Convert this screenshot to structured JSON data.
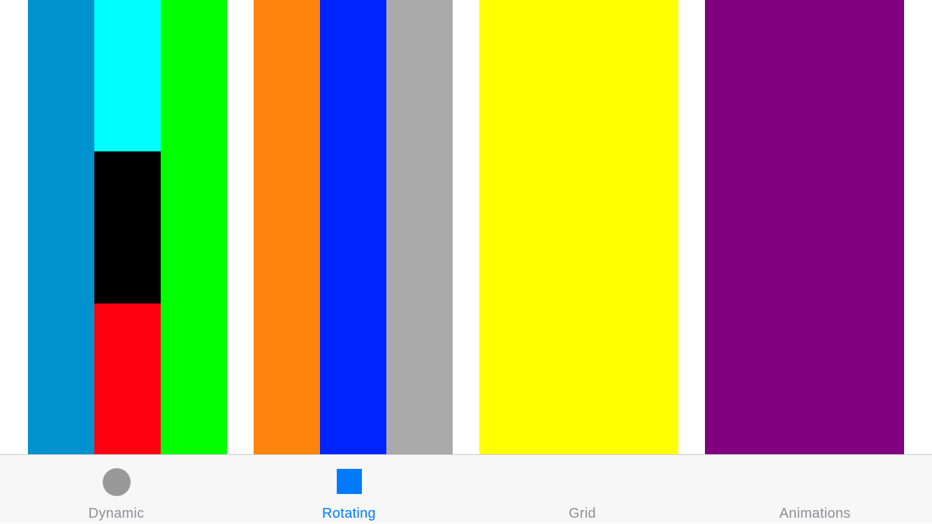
{
  "colors": {
    "teal": "#0091cf",
    "cyan": "#00ffff",
    "black": "#000000",
    "red": "#ff0010",
    "green": "#00ff00",
    "orange": "#ff840c",
    "blue": "#0024ff",
    "gray": "#aaaaaa",
    "yellow": "#ffff00",
    "purple": "#800080",
    "tab_active": "#007aff",
    "tab_inactive": "#8e8e93",
    "dynamic_icon": "#999999"
  },
  "tabbar": {
    "tabs": [
      {
        "label": "Dynamic",
        "icon": "circle-icon",
        "active": false
      },
      {
        "label": "Rotating",
        "icon": "square-icon",
        "active": true
      },
      {
        "label": "Grid",
        "icon": "",
        "active": false
      },
      {
        "label": "Animations",
        "icon": "",
        "active": false
      }
    ]
  }
}
